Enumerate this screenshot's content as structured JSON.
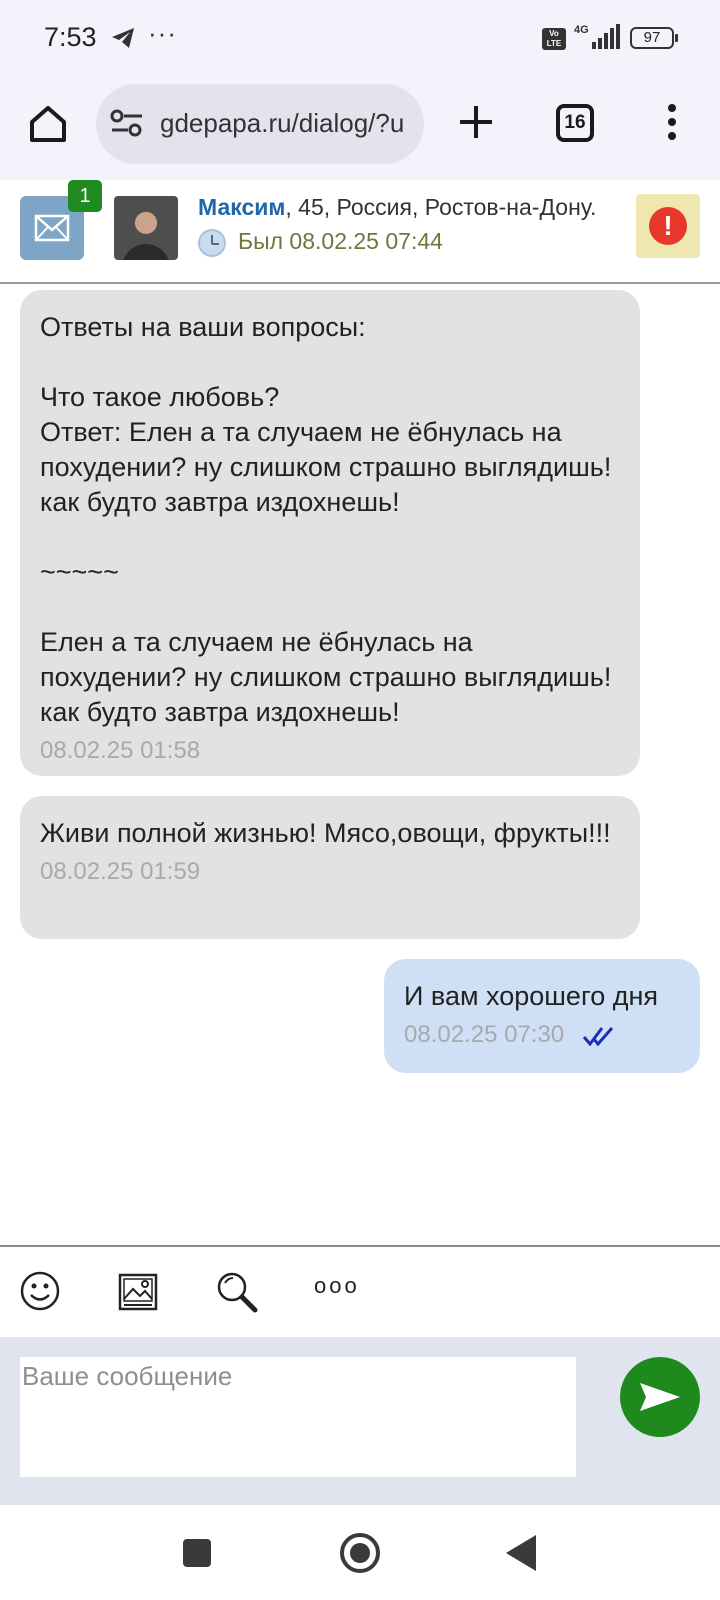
{
  "status_bar": {
    "time": "7:53",
    "more": "···",
    "volte": "Vo LTE",
    "network": "4G",
    "battery": "97"
  },
  "browser": {
    "url": "gdepapa.ru/dialog/?u",
    "tabs_count": "16",
    "icons": [
      "home-icon",
      "tune-icon",
      "plus-icon",
      "tabs-icon",
      "kebab-menu-icon"
    ]
  },
  "dialog_header": {
    "unread_count": "1",
    "user_name": "Максим",
    "user_details": ", 45, Россия, Ростов-на-Дону.",
    "last_seen": "Был 08.02.25 07:44",
    "alert_symbol": "!"
  },
  "messages": [
    {
      "direction": "in",
      "text": "Ответы на ваши вопросы:\n\nЧто такое любовь?\nОтвет: Елен а та случаем не ёбнулась на похудении? ну слишком страшно выглядишь! как будто завтра издохнешь!\n\n~~~~~\n\nЕлен а та случаем не ёбнулась на похудении? ну слишком страшно выглядишь! как будто завтра издохнешь!",
      "time": "08.02.25 01:58"
    },
    {
      "direction": "in",
      "text": "Живи полной жизнью! Мясо,овощи, фрукты!!!",
      "time": "08.02.25 01:59"
    },
    {
      "direction": "out",
      "text": "И вам хорошего дня",
      "time": "08.02.25 07:30",
      "status": "read"
    }
  ],
  "composer": {
    "placeholder": "Ваше сообщение",
    "tools": [
      "smiley-icon",
      "image-icon",
      "search-icon",
      "more-icon"
    ],
    "more_label": "ooo"
  },
  "colors": {
    "incoming_bubble": "#e2e2e2",
    "outgoing_bubble": "#cfe0f6",
    "send_button": "#1e8a1e",
    "user_name": "#2166a8",
    "badge": "#1f8a1f",
    "alert": "#e8372b"
  }
}
